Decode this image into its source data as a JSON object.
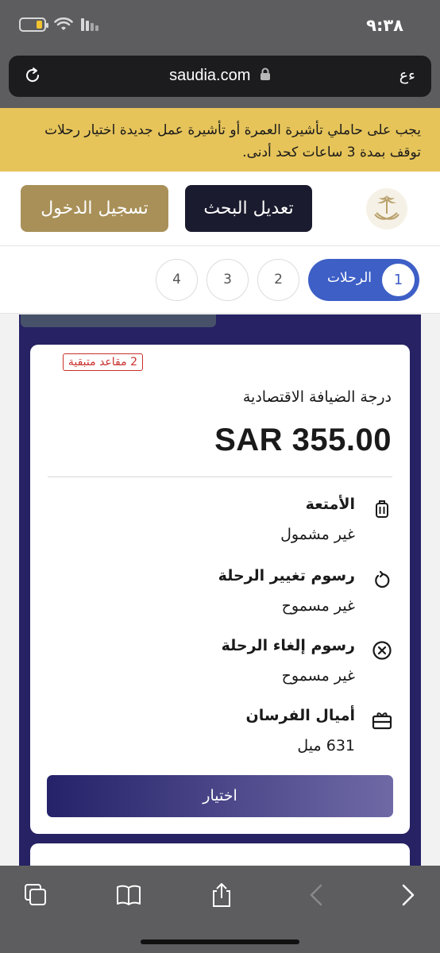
{
  "status_bar": {
    "time": "٩:٣٨"
  },
  "browser": {
    "url": "saudia.com",
    "text_size_label": "ءع"
  },
  "alert": {
    "text": "يجب على حاملي تأشيرة العمرة أو تأشيرة عمل جديدة اختيار رحلات توقف بمدة 3 ساعات كحد أدنى."
  },
  "header": {
    "edit_search_label": "تعديل البحث",
    "login_label": "تسجيل الدخول"
  },
  "steps": {
    "active": {
      "number": "1",
      "label": "الرحلات"
    },
    "others": [
      "2",
      "3",
      "4"
    ]
  },
  "fare_card": {
    "seats_left": "2 مقاعد متبقية",
    "fare_name": "درجة الضيافة الاقتصادية",
    "price": "SAR 355.00",
    "features": [
      {
        "title": "الأمتعة",
        "value": "غير مشمول",
        "icon": "luggage-icon"
      },
      {
        "title": "رسوم تغيير الرحلة",
        "value": "غير مسموح",
        "icon": "change-icon"
      },
      {
        "title": "رسوم إلغاء الرحلة",
        "value": "غير مسموح",
        "icon": "cancel-icon"
      },
      {
        "title": "أميال الفرسان",
        "value": "631 ميل",
        "icon": "gift-icon"
      }
    ],
    "select_label": "اختيار"
  },
  "colors": {
    "alert_bg": "#e6c45a",
    "primary_dark": "#1b1b2f",
    "gold": "#a89058",
    "step_active": "#3d5fc6",
    "panel": "#262263",
    "seats_badge": "#c9302c"
  }
}
